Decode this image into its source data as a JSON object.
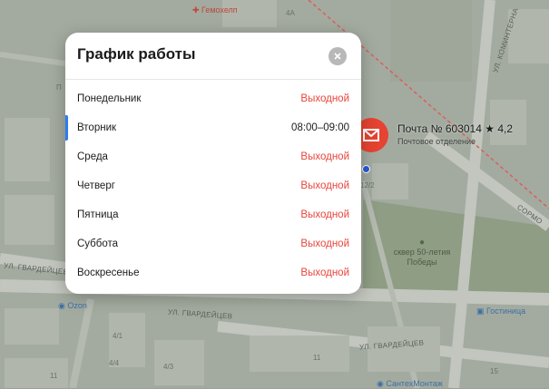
{
  "map": {
    "top_poi": "Гемохелп",
    "streets": {
      "gvardeytsev_left": "УЛ. ГВАРДЕЙЦЕВ",
      "gvardeytsev_mid": "УЛ. ГВАРДЕЙЦЕВ",
      "gvardeytsev_right": "УЛ. ГВАРДЕЙЦЕВ",
      "kominterna": "УЛ. КОМИНТЕРНА",
      "sormovo": "СОРМО"
    },
    "house_numbers": [
      "4А",
      "4/1",
      "12/2",
      "4/4",
      "4/3",
      "11",
      "15",
      "11",
      "П"
    ],
    "park_label": "сквер 50-летия Победы",
    "poi_ozon": "Ozon",
    "poi_hotel": "Гостиница",
    "poi_santehmontazh": "СантехМонтаж",
    "colors": {
      "pin": "#e64332",
      "poi": "#3f6fa3"
    }
  },
  "place": {
    "name": "Почта № 603014",
    "rating": "★ 4,2",
    "category": "Почтовое отделение",
    "icon": "envelope-icon"
  },
  "schedule": {
    "title": "График работы",
    "close_icon": "close-icon",
    "accent_color": "#2c7bf2",
    "off_color": "#e8453b",
    "days": [
      {
        "day": "Понедельник",
        "hours": "Выходной",
        "off": true,
        "today": false
      },
      {
        "day": "Вторник",
        "hours": "08:00–09:00",
        "off": false,
        "today": true
      },
      {
        "day": "Среда",
        "hours": "Выходной",
        "off": true,
        "today": false
      },
      {
        "day": "Четверг",
        "hours": "Выходной",
        "off": true,
        "today": false
      },
      {
        "day": "Пятница",
        "hours": "Выходной",
        "off": true,
        "today": false
      },
      {
        "day": "Суббота",
        "hours": "Выходной",
        "off": true,
        "today": false
      },
      {
        "day": "Воскресенье",
        "hours": "Выходной",
        "off": true,
        "today": false
      }
    ]
  }
}
